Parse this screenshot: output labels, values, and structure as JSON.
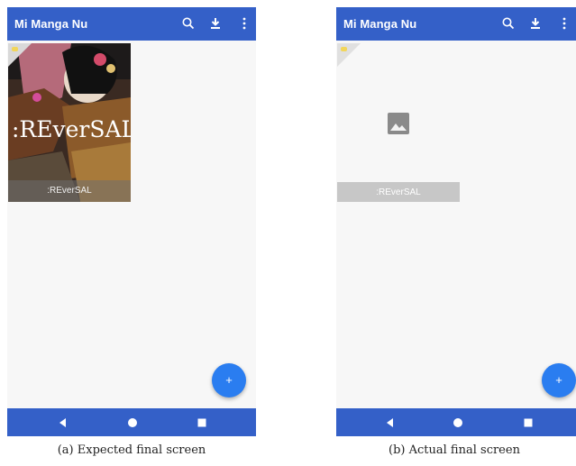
{
  "colors": {
    "appbar": "#3460c8",
    "fab": "#2a7df0",
    "navbar": "#3460c8"
  },
  "screens": [
    {
      "app_title": "Mi Manga Nu",
      "manga_title": ":REverSAL",
      "cover_text": ":REverSAL",
      "fab_label": "+",
      "caption": "(a) Expected final screen"
    },
    {
      "app_title": "Mi Manga Nu",
      "manga_title": ":REverSAL",
      "fab_label": "+",
      "caption": "(b) Actual final screen"
    }
  ],
  "icons": [
    "search-icon",
    "download-icon",
    "more-vert-icon",
    "image-placeholder-icon",
    "back-icon",
    "home-icon",
    "recents-icon"
  ]
}
